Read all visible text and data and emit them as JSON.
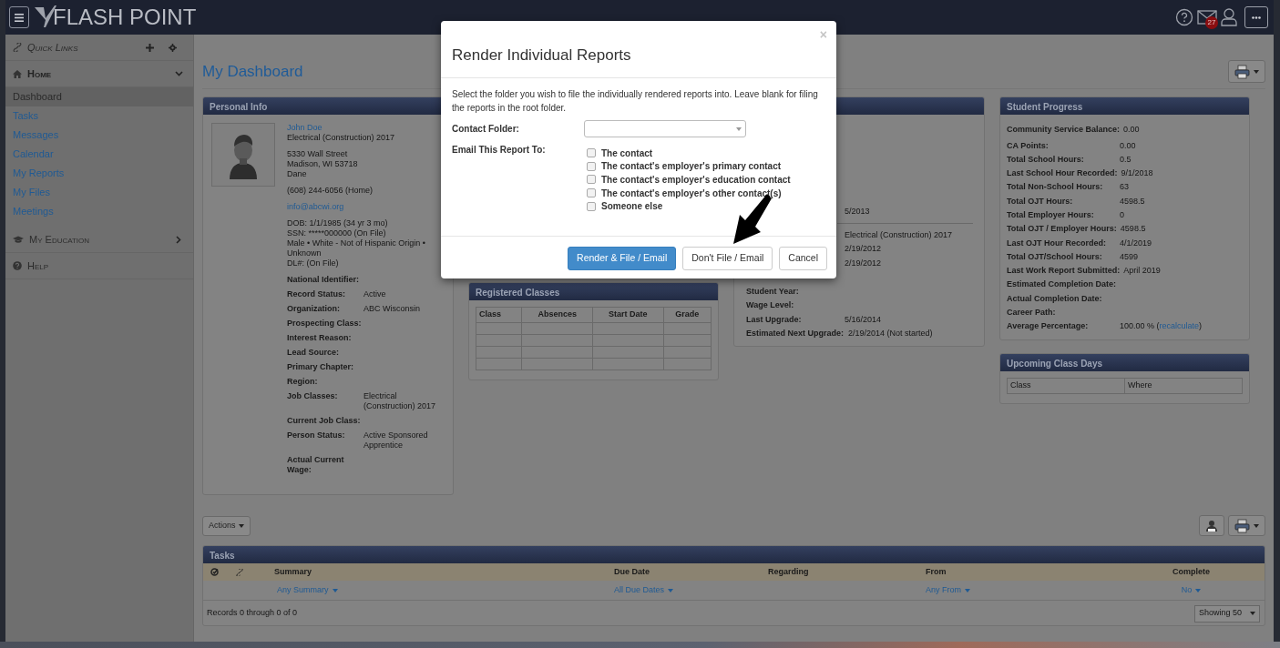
{
  "topbar": {
    "logo": "FLASH POINT",
    "mail_badge": "27"
  },
  "sidebar": {
    "quick_links": "Quick Links",
    "sections": [
      {
        "label": "Home",
        "expanded": true,
        "items": [
          {
            "label": "Dashboard",
            "selected": true
          },
          {
            "label": "Tasks",
            "selected": false
          },
          {
            "label": "Messages",
            "selected": false
          },
          {
            "label": "Calendar",
            "selected": false
          },
          {
            "label": "My Reports",
            "selected": false
          },
          {
            "label": "My Files",
            "selected": false
          },
          {
            "label": "Meetings",
            "selected": false
          }
        ]
      },
      {
        "label": "My Education",
        "expanded": false
      },
      {
        "label": "Help"
      }
    ]
  },
  "page_title": "My Dashboard",
  "personal_info": {
    "title": "Personal Info",
    "contact_blocks": [
      [
        {
          "kind": "link",
          "text": "John Doe"
        },
        {
          "kind": "text",
          "text": "Electrical (Construction) 2017"
        }
      ],
      [
        {
          "kind": "text",
          "text": "5330 Wall Street"
        },
        {
          "kind": "text",
          "text": "Madison, WI 53718"
        },
        {
          "kind": "text",
          "text": "Dane"
        }
      ],
      [
        {
          "kind": "text",
          "text": "(608) 244-6056 (Home)"
        }
      ],
      [
        {
          "kind": "link",
          "text": "info@abcwi.org"
        }
      ],
      [
        {
          "kind": "text",
          "text": "DOB: 1/1/1985 (34 yr 3 mo)"
        },
        {
          "kind": "text",
          "text": "SSN: *****000000 (On File)"
        },
        {
          "kind": "text",
          "text": "Male • White - Not of Hispanic Origin • Unknown"
        },
        {
          "kind": "text",
          "text": "DL#: (On File)"
        }
      ]
    ],
    "fields": [
      {
        "label": "National Identifier:"
      },
      {
        "label": "Record Status:",
        "value": "Active"
      },
      {
        "label": "Organization:",
        "value": "ABC Wisconsin"
      },
      {
        "label": "Prospecting Class:"
      },
      {
        "label": "Interest Reason:"
      },
      {
        "label": "Lead Source:"
      },
      {
        "label": "Primary Chapter:"
      },
      {
        "label": "Region:"
      },
      {
        "label": "Job Classes:",
        "value": "Electrical (Construction) 2017"
      },
      {
        "label": "Current Job Class:"
      },
      {
        "label": "Person Status:",
        "value": "Active Sponsored Apprentice"
      },
      {
        "label": "Actual Current Wage:"
      }
    ]
  },
  "registered_classes": {
    "title": "Registered Classes",
    "columns": [
      "Class",
      "Absences",
      "Start Date",
      "Grade"
    ]
  },
  "employment": {
    "rows": [
      {
        "kind": "row",
        "value": "5/2013"
      },
      {
        "kind": "divider"
      },
      {
        "kind": "row",
        "value": "Electrical (Construction) 2017"
      },
      {
        "kind": "row",
        "value": "2/19/2012"
      },
      {
        "kind": "row",
        "value": "2/19/2012"
      },
      {
        "kind": "row"
      },
      {
        "kind": "row",
        "label": "Student Year:"
      },
      {
        "kind": "row",
        "label": "Wage Level:"
      },
      {
        "kind": "row",
        "label": "Last Upgrade:",
        "value": "5/16/2014"
      },
      {
        "kind": "row",
        "label": "Estimated Next Upgrade:",
        "value": "2/19/2014 (Not started)"
      }
    ]
  },
  "student_progress": {
    "title": "Student Progress",
    "rows": [
      {
        "label": "Community Service Balance:",
        "value": "0.00"
      },
      {
        "label": "CA Points:",
        "value": "0.00"
      },
      {
        "label": "Total School Hours:",
        "value": "0.5"
      },
      {
        "label": "Last School Hour Recorded:",
        "value": "9/1/2018"
      },
      {
        "label": "Total Non-School Hours:",
        "value": "63"
      },
      {
        "label": "Total OJT Hours:",
        "value": "4598.5"
      },
      {
        "label": "Total Employer Hours:",
        "value": "0"
      },
      {
        "label": "Total OJT / Employer Hours:",
        "value": "4598.5"
      },
      {
        "label": "Last OJT Hour Recorded:",
        "value": "4/1/2019"
      },
      {
        "label": "Total OJT/School Hours:",
        "value": "4599"
      },
      {
        "label": "Last Work Report Submitted:",
        "value": "April 2019"
      },
      {
        "label": "Estimated Completion Date:"
      },
      {
        "label": "Actual Completion Date:"
      },
      {
        "label": "Career Path:"
      },
      {
        "label": "Average Percentage:",
        "value": "100.00 % (",
        "link": "recalculate",
        "value_after": ")"
      }
    ]
  },
  "upcoming_class_days": {
    "title": "Upcoming Class Days",
    "columns": [
      "Class",
      "Where"
    ]
  },
  "actions_button": "Actions",
  "tasks": {
    "title": "Tasks",
    "columns": [
      {
        "label": "Summary",
        "filter": "Any Summary"
      },
      {
        "label": "Due Date",
        "filter": "All Due Dates"
      },
      {
        "label": "Regarding"
      },
      {
        "label": "From",
        "filter": "Any From"
      },
      {
        "label": "Complete",
        "filter": "No"
      }
    ],
    "records": "Records 0 through 0 of 0",
    "page_size": "Showing 50"
  },
  "modal": {
    "title": "Render Individual Reports",
    "close": "×",
    "description": "Select the folder you wish to file the individually rendered reports into. Leave blank for filing the reports in the root folder.",
    "folder_label": "Contact Folder:",
    "email_label": "Email This Report To:",
    "recipients": [
      {
        "label": "The contact",
        "checked": false
      },
      {
        "label": "The contact's employer's primary contact",
        "checked": false
      },
      {
        "label": "The contact's employer's education contact",
        "checked": false
      },
      {
        "label": "The contact's employer's other contact(s)",
        "checked": false
      },
      {
        "label": "Someone else",
        "checked": false
      }
    ],
    "buttons": [
      {
        "label": "Render & File / Email",
        "kind": "primary"
      },
      {
        "label": "Don't File / Email",
        "kind": "default"
      },
      {
        "label": "Cancel",
        "kind": "default"
      }
    ]
  }
}
